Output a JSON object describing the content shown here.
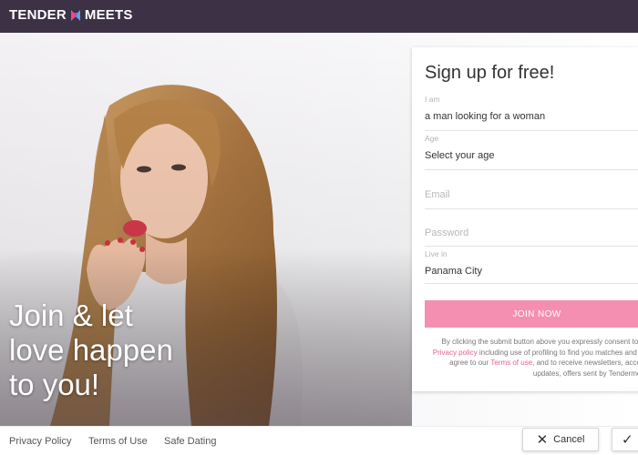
{
  "brand": {
    "logo_left": "TENDER",
    "logo_right": "MEETS",
    "heart_colors": [
      "#e94d8b",
      "#5aa2e6"
    ]
  },
  "hero": {
    "tagline_line1": "Join & let",
    "tagline_line2": "love happen",
    "tagline_line3": "to you!",
    "image_description_icon": "woman-blowing-kiss-photo"
  },
  "signup": {
    "title": "Sign up for free!",
    "iam_label": "I am",
    "iam_value": "a man looking for a woman",
    "age_label": "Age",
    "age_value": "Select your age",
    "email_placeholder": "Email",
    "password_placeholder": "Password",
    "live_label": "Live in",
    "live_value": "Panama City",
    "join_label": "JOIN NOW",
    "consent_prefix": "By clicking the submit button above you expressly consent to our",
    "consent_privacy": "Privacy policy",
    "consent_mid": "including use of profiling to find you matches and you agree to our",
    "consent_terms": "Terms of use",
    "consent_suffix": ", and to receive newsletters, account updates, offers sent by Tendermeets"
  },
  "footer": {
    "privacy": "Privacy Policy",
    "terms": "Terms of Use",
    "safe": "Safe Dating"
  },
  "actions": {
    "cancel_label": "Cancel",
    "cancel_icon": "close-icon",
    "accept_icon": "checkmark-icon"
  },
  "colors": {
    "topbar": "#3d3146",
    "accent_pink": "#f48fb1",
    "link_pink": "#e8608f"
  }
}
